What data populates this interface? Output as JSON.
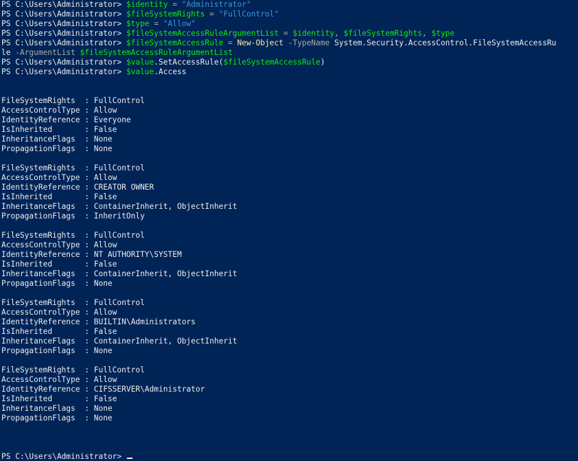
{
  "prompt": "PS C:\\Users\\Administrator> ",
  "commands": [
    {
      "tokens": [
        {
          "t": "$identity",
          "c": "var"
        },
        {
          "t": " = ",
          "c": "op"
        },
        {
          "t": "\"Administrator\"",
          "c": "str"
        }
      ]
    },
    {
      "tokens": [
        {
          "t": "$fileSystemRights",
          "c": "var"
        },
        {
          "t": " = ",
          "c": "op"
        },
        {
          "t": "\"FullControl\"",
          "c": "str"
        }
      ]
    },
    {
      "tokens": [
        {
          "t": "$type",
          "c": "var"
        },
        {
          "t": " = ",
          "c": "op"
        },
        {
          "t": "\"Allow\"",
          "c": "str"
        }
      ]
    },
    {
      "tokens": [
        {
          "t": "$fileSystemAccessRuleArgumentList",
          "c": "var"
        },
        {
          "t": " = ",
          "c": "op"
        },
        {
          "t": "$identity",
          "c": "var"
        },
        {
          "t": ", ",
          "c": "op"
        },
        {
          "t": "$fileSystemRights",
          "c": "var"
        },
        {
          "t": ", ",
          "c": "op"
        },
        {
          "t": "$type",
          "c": "var"
        }
      ]
    },
    {
      "tokens": [
        {
          "t": "$fileSystemAccessRule",
          "c": "var"
        },
        {
          "t": " = ",
          "c": "op"
        },
        {
          "t": "New-Object",
          "c": "cmd"
        },
        {
          "t": " -TypeName ",
          "c": "param"
        },
        {
          "t": "System.Security.AccessControl.FileSystemAccessRu",
          "c": "plain"
        }
      ],
      "wrap": [
        {
          "t": "le",
          "c": "plain"
        },
        {
          "t": " -ArgumentList ",
          "c": "param"
        },
        {
          "t": "$fileSystemAccessRuleArgumentList",
          "c": "var"
        }
      ]
    },
    {
      "tokens": [
        {
          "t": "$value",
          "c": "var"
        },
        {
          "t": ".SetAccessRule(",
          "c": "plain"
        },
        {
          "t": "$fileSystemAccessRule",
          "c": "var"
        },
        {
          "t": ")",
          "c": "plain"
        }
      ]
    },
    {
      "tokens": [
        {
          "t": "$value",
          "c": "var"
        },
        {
          "t": ".Access",
          "c": "plain"
        }
      ]
    }
  ],
  "field_labels": {
    "rights": "FileSystemRights  : ",
    "type": "AccessControlType : ",
    "identity": "IdentityReference : ",
    "inherited": "IsInherited       : ",
    "inheritance": "InheritanceFlags  : ",
    "propagation": "PropagationFlags  : "
  },
  "entries": [
    {
      "rights": "FullControl",
      "type": "Allow",
      "identity": "Everyone",
      "inherited": "False",
      "inheritance": "None",
      "propagation": "None"
    },
    {
      "rights": "FullControl",
      "type": "Allow",
      "identity": "CREATOR OWNER",
      "inherited": "False",
      "inheritance": "ContainerInherit, ObjectInherit",
      "propagation": "InheritOnly"
    },
    {
      "rights": "FullControl",
      "type": "Allow",
      "identity": "NT AUTHORITY\\SYSTEM",
      "inherited": "False",
      "inheritance": "ContainerInherit, ObjectInherit",
      "propagation": "None"
    },
    {
      "rights": "FullControl",
      "type": "Allow",
      "identity": "BUILTIN\\Administrators",
      "inherited": "False",
      "inheritance": "ContainerInherit, ObjectInherit",
      "propagation": "None"
    },
    {
      "rights": "FullControl",
      "type": "Allow",
      "identity": "CIFSSERVER\\Administrator",
      "inherited": "False",
      "inheritance": "None",
      "propagation": "None"
    }
  ],
  "colors": {
    "background": "#012456",
    "text": "#eeedf0",
    "variable": "#13e80f",
    "string": "#3a96dd",
    "operator": "#a9a9a9",
    "command": "#f9f1a5"
  }
}
